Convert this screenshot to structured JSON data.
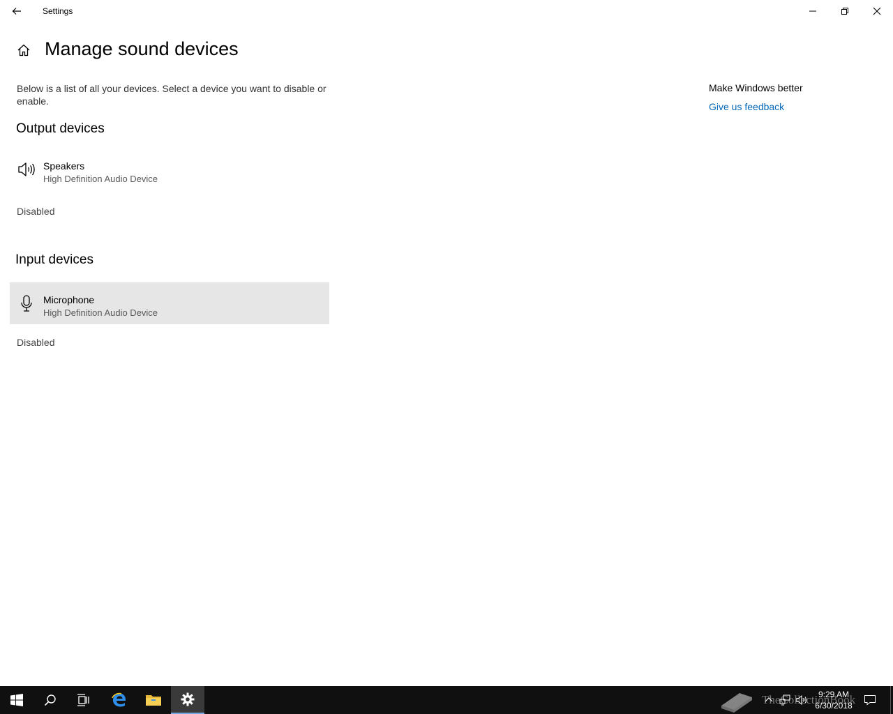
{
  "window": {
    "title": "Settings"
  },
  "page": {
    "title": "Manage sound devices",
    "description": "Below is a list of all your devices. Select a device you want to disable or enable."
  },
  "output": {
    "heading": "Output devices",
    "device": {
      "name": "Speakers",
      "subtitle": "High Definition Audio Device",
      "icon": "speaker-icon"
    },
    "status": "Disabled"
  },
  "input": {
    "heading": "Input devices",
    "device": {
      "name": "Microphone",
      "subtitle": "High Definition Audio Device",
      "icon": "microphone-icon",
      "selected": true
    },
    "status": "Disabled"
  },
  "sidebar": {
    "title": "Make Windows better",
    "link": "Give us feedback"
  },
  "taskbar": {
    "time": "9:29 AM",
    "date": "6/30/2018",
    "watermark": "TheCollectionBook",
    "apps": [
      "start-icon",
      "search-icon",
      "task-view-icon",
      "edge-icon",
      "file-explorer-icon",
      "settings-icon"
    ]
  },
  "colors": {
    "accent": "#0067b8",
    "selected_bg": "#e6e6e6",
    "taskbar_bg": "#101010"
  }
}
